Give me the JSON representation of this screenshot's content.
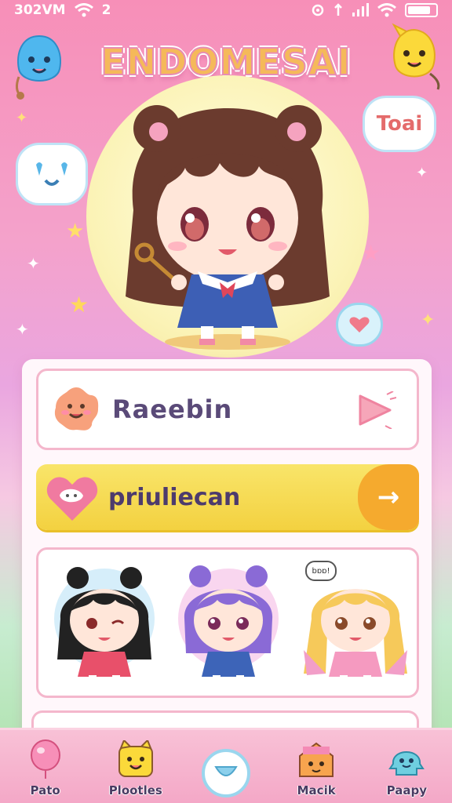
{
  "status": {
    "time": "302VM",
    "signal_text": "2"
  },
  "app": {
    "title": "ENDOMESAI"
  },
  "bubbles": {
    "top_right": "Toai"
  },
  "menu": {
    "primary_label": "Raeebin",
    "secondary_label": "priuliecan"
  },
  "characters": {
    "right_speech": "bɒɒ!"
  },
  "nav": {
    "items": [
      {
        "label": "Pato",
        "icon": "balloon-icon"
      },
      {
        "label": "Plootles",
        "icon": "yellow-cat-icon"
      },
      {
        "label": "",
        "icon": "home-bubble-icon"
      },
      {
        "label": "Macik",
        "icon": "house-cat-icon"
      },
      {
        "label": "Paapy",
        "icon": "blue-ghost-icon"
      }
    ]
  },
  "colors": {
    "accent_pink": "#f4a8c7",
    "accent_yellow": "#f3d140",
    "accent_orange": "#f5aa2e",
    "text_purple": "#5a4a78"
  }
}
